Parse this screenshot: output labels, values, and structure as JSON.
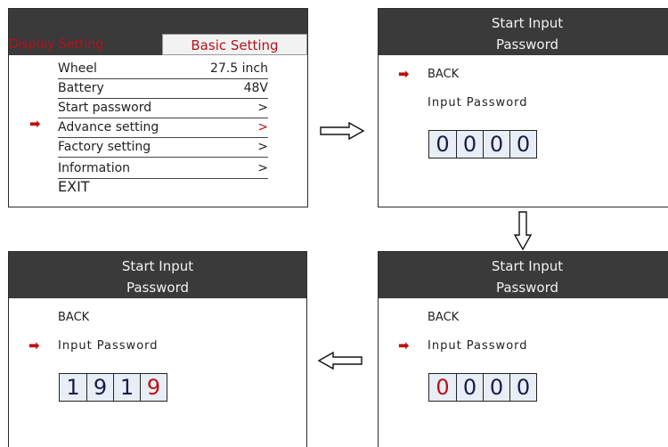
{
  "panel1": {
    "tab_display": "Display Setting",
    "tab_basic": "Basic Setting",
    "rows": [
      {
        "label": "Wheel",
        "value": "27.5 inch"
      },
      {
        "label": "Battery",
        "value": "48V"
      },
      {
        "label": "Start password",
        "value": ">"
      },
      {
        "label": "Advance setting",
        "value": ">"
      },
      {
        "label": "Factory setting",
        "value": ">"
      },
      {
        "label": "Information",
        "value": ">"
      }
    ],
    "exit": "EXIT"
  },
  "panel2": {
    "title_line1": "Start Input",
    "title_line2": "Password",
    "back": "BACK",
    "input_label": "Input Password",
    "digits": [
      "0",
      "0",
      "0",
      "0"
    ]
  },
  "panel3": {
    "title_line1": "Start Input",
    "title_line2": "Password",
    "back": "BACK",
    "input_label": "Input Password",
    "digits": [
      "0",
      "0",
      "0",
      "0"
    ]
  },
  "panel4": {
    "title_line1": "Start Input",
    "title_line2": "Password",
    "back": "BACK",
    "input_label": "Input Password",
    "digits": [
      "1",
      "9",
      "1",
      "9"
    ]
  },
  "colors": {
    "accent_red": "#c01010",
    "header_gray": "#3a3a3a"
  }
}
